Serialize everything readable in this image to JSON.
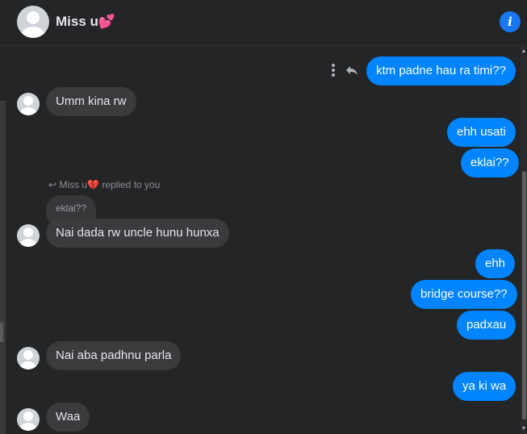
{
  "header": {
    "title": "Miss u💕"
  },
  "reply": {
    "note": "Miss u💔 replied to you",
    "quoted_text": "eklai??"
  },
  "messages": [
    "ktm padne hau ra timi??",
    "Umm kina rw",
    "ehh usati",
    "eklai??",
    "Nai dada rw uncle hunu hunxa",
    "ehh",
    "bridge course??",
    "padxau",
    "Nai  aba padhnu parla",
    "ya ki wa",
    "Waa"
  ],
  "colors": {
    "outgoing": "#0084ff",
    "incoming": "#3a3b3c",
    "background": "#242526",
    "info": "#1877f2"
  },
  "icons": {
    "info": "info-icon",
    "more": "more-vertical-icon",
    "reply": "reply-icon"
  }
}
